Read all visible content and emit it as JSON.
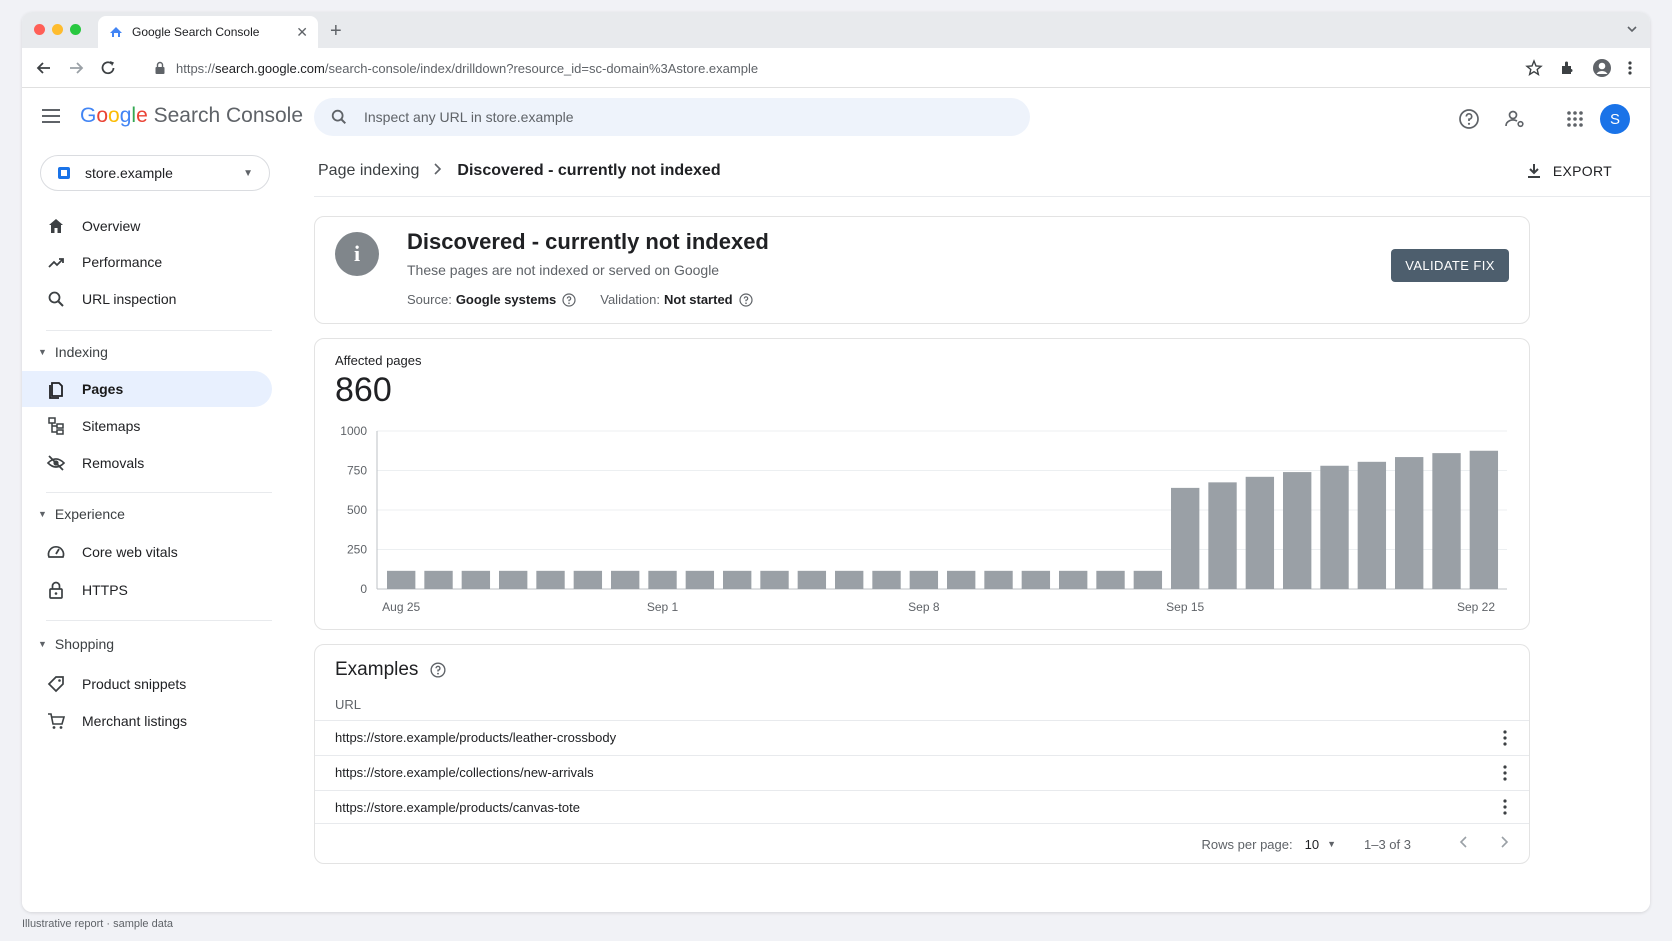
{
  "browser": {
    "tab_title": "Google Search Console",
    "url_prefix": "https://",
    "url_host": "search.google.com",
    "url_path": "/search-console/index/drilldown?resource_id=sc-domain%3Astore.example"
  },
  "header": {
    "logo_google": [
      "G",
      "o",
      "o",
      "g",
      "l",
      "e"
    ],
    "logo_product": "Search Console",
    "search_placeholder": "Inspect any URL in store.example",
    "avatar_letter": "S"
  },
  "sidebar": {
    "property": "store.example",
    "top_items": [
      {
        "label": "Overview",
        "icon": "home-icon"
      },
      {
        "label": "Performance",
        "icon": "trending-up-icon"
      },
      {
        "label": "URL inspection",
        "icon": "search-icon"
      }
    ],
    "sections": [
      {
        "title": "Indexing",
        "items": [
          {
            "label": "Pages",
            "icon": "pages-icon",
            "active": true
          },
          {
            "label": "Sitemaps",
            "icon": "sitemap-icon"
          },
          {
            "label": "Removals",
            "icon": "eye-off-icon"
          }
        ]
      },
      {
        "title": "Experience",
        "items": [
          {
            "label": "Core web vitals",
            "icon": "gauge-icon"
          },
          {
            "label": "HTTPS",
            "icon": "lock-icon"
          }
        ]
      },
      {
        "title": "Shopping",
        "items": [
          {
            "label": "Product snippets",
            "icon": "tag-icon"
          },
          {
            "label": "Merchant listings",
            "icon": "cart-icon"
          }
        ]
      }
    ]
  },
  "breadcrumb": {
    "parent": "Page indexing",
    "current": "Discovered - currently not indexed",
    "export_label": "EXPORT"
  },
  "issue": {
    "title": "Discovered - currently not indexed",
    "subtitle": "These pages are not indexed or served on Google",
    "source_label": "Source:",
    "source_value": "Google systems",
    "validation_label": "Validation:",
    "validation_value": "Not started",
    "validate_button": "VALIDATE FIX"
  },
  "affected": {
    "label": "Affected pages",
    "count": "860"
  },
  "chart_data": {
    "type": "bar",
    "title": "",
    "xlabel": "",
    "ylabel": "",
    "ylim": [
      0,
      1000
    ],
    "yticks": [
      0,
      250,
      500,
      750,
      1000
    ],
    "x_tick_labels": [
      "Aug 25",
      "Sep 1",
      "Sep 8",
      "Sep 15",
      "Sep 22"
    ],
    "categories": [
      "Aug 25",
      "Aug 26",
      "Aug 27",
      "Aug 28",
      "Aug 29",
      "Aug 30",
      "Aug 31",
      "Sep 1",
      "Sep 2",
      "Sep 3",
      "Sep 4",
      "Sep 5",
      "Sep 6",
      "Sep 7",
      "Sep 8",
      "Sep 9",
      "Sep 10",
      "Sep 11",
      "Sep 12",
      "Sep 13",
      "Sep 14",
      "Sep 15",
      "Sep 16",
      "Sep 17",
      "Sep 18",
      "Sep 19",
      "Sep 20",
      "Sep 21",
      "Sep 22"
    ],
    "values": [
      115,
      115,
      115,
      115,
      115,
      115,
      115,
      115,
      115,
      115,
      115,
      115,
      115,
      115,
      115,
      115,
      115,
      115,
      115,
      115,
      115,
      640,
      675,
      710,
      740,
      780,
      805,
      835,
      860,
      875
    ],
    "bar_color": "#9aa0a6"
  },
  "examples": {
    "title": "Examples",
    "column": "URL",
    "rows": [
      "https://store.example/products/leather-crossbody",
      "https://store.example/collections/new-arrivals",
      "https://store.example/products/canvas-tote"
    ],
    "rows_per_page_label": "Rows per page:",
    "rows_per_page": "10",
    "range": "1–3 of 3"
  },
  "footer": "Illustrative report · sample data",
  "colors": {
    "accent": "#1a73e8",
    "active_nav_bg": "#e8f0fe",
    "validate_bg": "#4d5e6d"
  }
}
